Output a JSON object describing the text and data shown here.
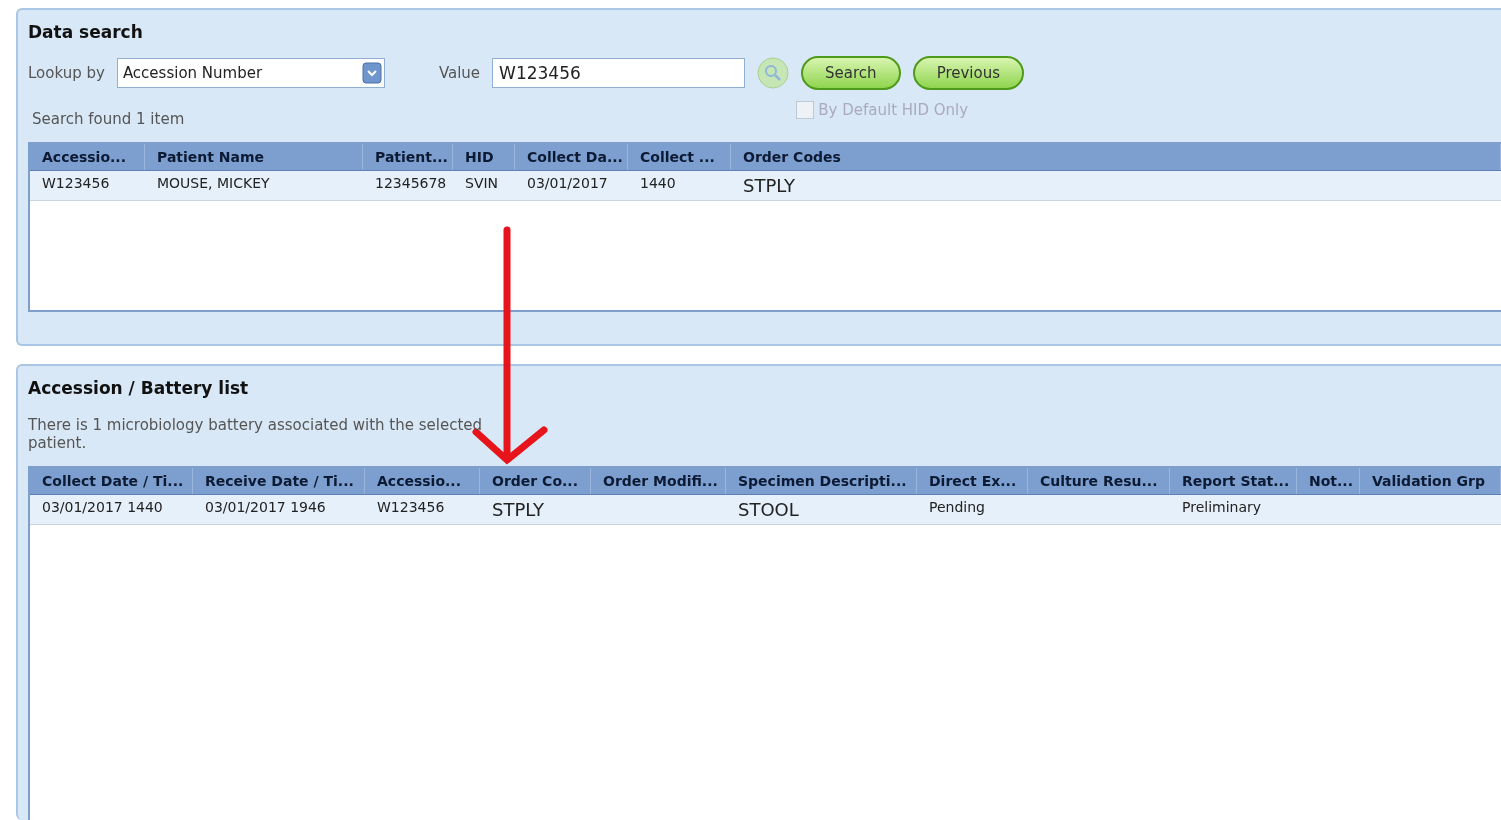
{
  "data_search": {
    "title": "Data search",
    "lookup_label": "Lookup by",
    "lookup_value": "Accession Number",
    "value_label": "Value",
    "value": "W123456",
    "buttons": [
      "Search",
      "Previous"
    ],
    "default_hid_only": {
      "label": "By Default HID Only",
      "checked": false,
      "disabled": true
    },
    "result_text": "Search found 1 item",
    "table": {
      "columns": [
        "Accessio...",
        "Patient Name",
        "Patient...",
        "HID",
        "Collect Da...",
        "Collect ...",
        "Order Codes"
      ],
      "rows": [
        {
          "selected": true,
          "cells": [
            "W123456",
            "MOUSE, MICKEY",
            "12345678",
            "SVIN",
            "03/01/2017",
            "1440",
            "STPLY"
          ]
        }
      ]
    }
  },
  "battery_list": {
    "title": "Accession / Battery list",
    "message": "There is 1 microbiology battery associated with the selected patient.",
    "table": {
      "columns": [
        "Collect Date / Ti...",
        "Receive Date / Ti...",
        "Accessio...",
        "Order Co...",
        "Order Modifi...",
        "Specimen Descripti...",
        "Direct Ex...",
        "Culture Resu...",
        "Report Stat...",
        "Not...",
        "Validation Grp"
      ],
      "rows": [
        {
          "selected": true,
          "cells": [
            "03/01/2017 1440",
            "03/01/2017 1946",
            "W123456",
            "STPLY",
            "",
            "STOOL",
            "Pending",
            "",
            "Preliminary",
            "",
            ""
          ]
        }
      ]
    }
  }
}
